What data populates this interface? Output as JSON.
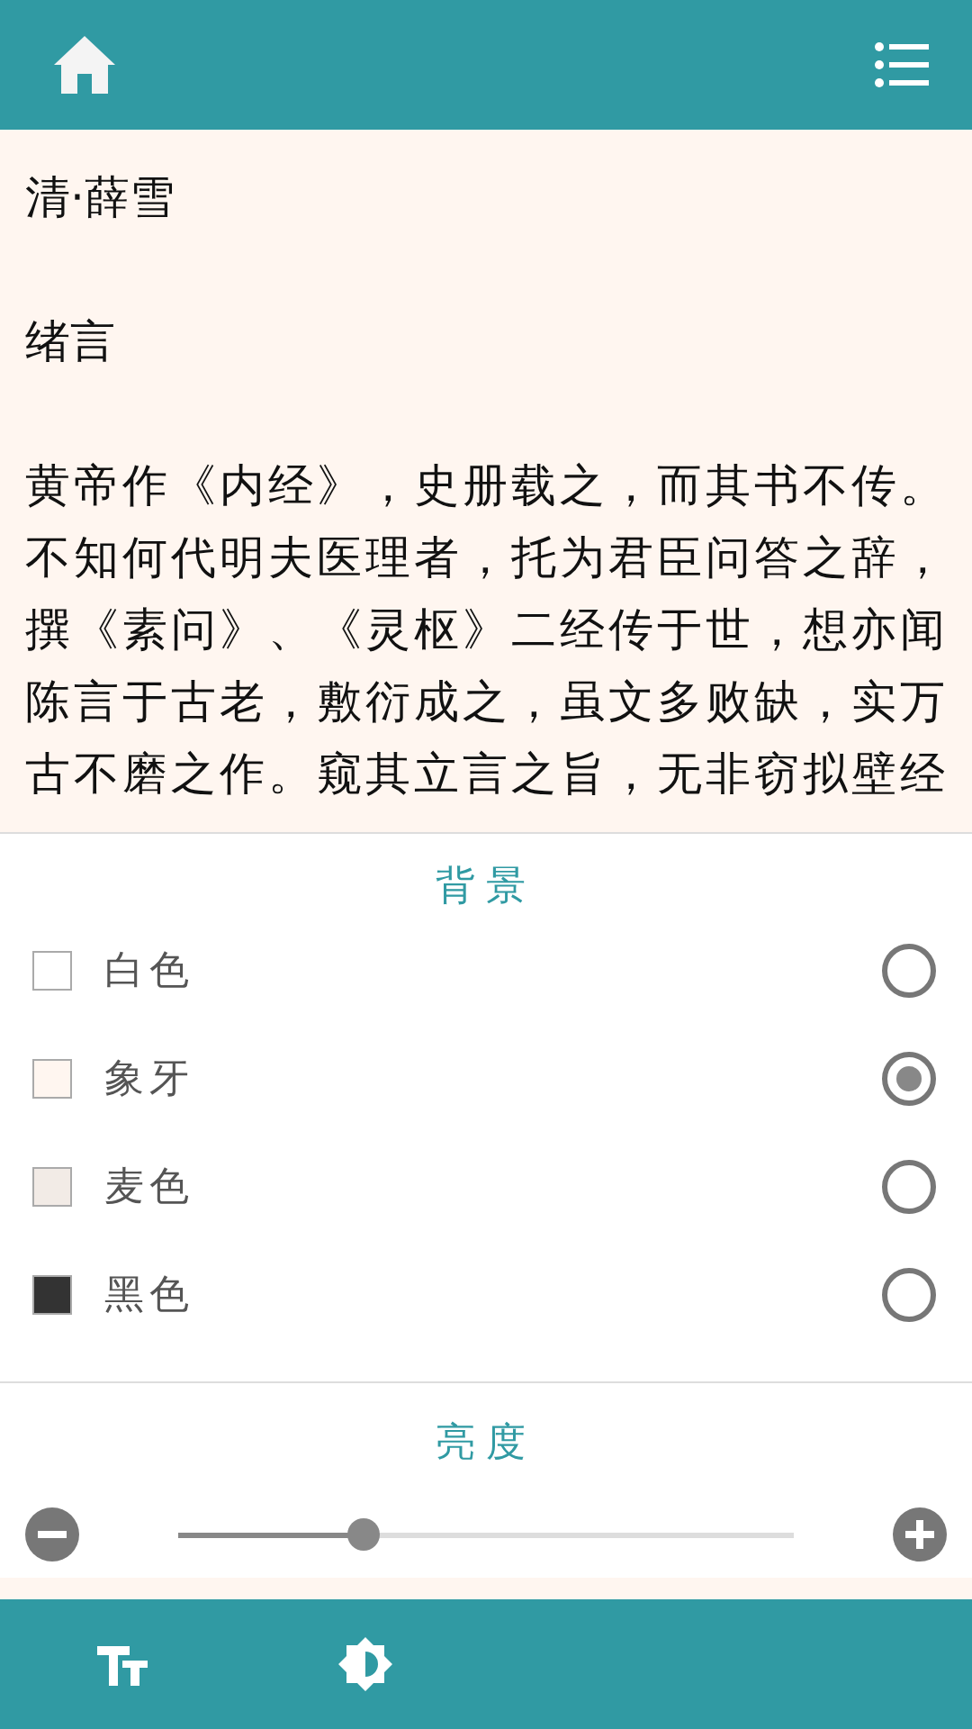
{
  "reader": {
    "author": "清·薛雪",
    "heading": "绪言",
    "paragraph": "黄帝作《内经》，史册载之，而其书不传。不知何代明夫医理者，托为君臣问答之辞，撰《素问》、《灵枢》二经传于世，想亦闻陈言于古老，敷衍成之，虽文多败缺，实万古不磨之作。窥其立言之旨，无非窃拟壁经"
  },
  "background_panel": {
    "title": "背景",
    "options": [
      {
        "label": "白色",
        "color": "#ffffff",
        "selected": false
      },
      {
        "label": "象牙",
        "color": "#fff6f0",
        "selected": true
      },
      {
        "label": "麦色",
        "color": "#f2ebe6",
        "selected": false
      },
      {
        "label": "黑色",
        "color": "#333333",
        "selected": false
      }
    ]
  },
  "brightness_panel": {
    "title": "亮度",
    "level": 0.3
  },
  "bottom_bar": [
    {
      "kind": "font"
    },
    {
      "kind": "brightness"
    }
  ]
}
